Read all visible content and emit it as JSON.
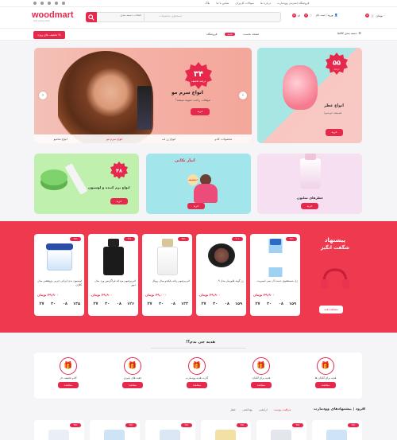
{
  "topbar": {
    "links": [
      "فروشگاه اینترنتی وودمارت",
      "درباره ما",
      "سوالات کاربران",
      "تماس با ما",
      "بلاگ"
    ],
    "social": [
      "instagram-icon",
      "telegram-icon",
      "twitter-icon",
      "aparat-icon",
      "whatsapp-icon"
    ]
  },
  "header": {
    "logo": "woodmart",
    "logo_sub": "Your online shop",
    "search_placeholder": "جستجوی محصولات",
    "category_select": "انتخاب دسته بندی",
    "login_label": "ورود / ثبت نام",
    "wishlist_count": "0",
    "compare_count": "0",
    "cart_label": "۰ تومان",
    "cart_count": "0"
  },
  "nav": {
    "categories_label": "دسته بندی کالاها",
    "items": [
      "صفحه نخست",
      "فروشگاه"
    ],
    "hot": "جدید",
    "cta": "% تخفیف های ویژه"
  },
  "hero": {
    "badge_value": "۳۴",
    "badge_unit": "درصد تخفیف",
    "title": "انواع سرم مو",
    "subtitle": "موهات راحت شونه میشه!",
    "button": "خرید",
    "tabs": [
      "محصولات کادو",
      "انواع رژ لب",
      "انواع سرم مو",
      "انواع شامپو"
    ]
  },
  "perfume_banner": {
    "badge_value": "۵۵",
    "badge_unit": "درصد",
    "title": "انواع عطر",
    "subtitle": "همیشه خوشبو!",
    "button": "خرید"
  },
  "small_banners": [
    {
      "badge": "۴۸",
      "title": "انواع نرم کننده و لوسیون",
      "button": "خرید"
    },
    {
      "badge": "",
      "title": "انبار تکانی",
      "tag": "٪تخفیف",
      "button": "خرید"
    },
    {
      "badge": "",
      "title": "عطرهای سلنون",
      "button": "خرید"
    }
  ],
  "amazing": {
    "line1": "پیشنهاد",
    "line2": "شگفت انگیز",
    "button": "مشاهده همه",
    "products": [
      {
        "name": "لوسیون بدن ایرانی چربی پژوهشی مدل کلاژن",
        "old": "",
        "price": "۳۹,۹۰۰ تومان",
        "disc": "۳۸٪",
        "timer": [
          "۱۳۵",
          "۰۸",
          "۳۰",
          "۲۷"
        ]
      },
      {
        "name": "ادو پرفیوم مردانه فراگرنس ورد مدل دیور",
        "old": "",
        "price": "۳۹,۹۰۰ تومان",
        "disc": "۲۹٪",
        "timer": [
          "۱۲۶",
          "۰۸",
          "۳۰",
          "۲۷"
        ]
      },
      {
        "name": "ادو پرفیوم زنانه بایلندو مدل رویال",
        "old": "",
        "price": "۴۹,۰۰۰ تومان",
        "disc": "۴۵٪",
        "timer": [
          "۱۳۳",
          "۰۸",
          "۳۰",
          "۲۷"
        ]
      },
      {
        "name": "رژ گونه فلورمار مدل ۰۹",
        "old": "",
        "price": "۳۹,۹۰۰ تومان",
        "disc": "۳۰٪",
        "timer": [
          "۱۵۹",
          "۰۸",
          "۳۰",
          "۲۷"
        ]
      },
      {
        "name": "ژل شستشوی دست آن سی اسپریت",
        "old": "",
        "price": "۳۹,۹۰۰ تومان",
        "disc": "۲۵٪",
        "timer": [
          "۱۵۹",
          "۰۸",
          "۳۰",
          "۲۷"
        ]
      }
    ]
  },
  "gift": {
    "title": "هدیه چی بدم؟!",
    "items": [
      {
        "label": "هدیه برای آقایان ها",
        "button": "مشاهده"
      },
      {
        "label": "هدیه برای آقایان",
        "button": "مشاهده"
      },
      {
        "label": "کارت هدیه وودمارت",
        "button": "مشاهده"
      },
      {
        "label": "جعبه های پاییزی",
        "button": "مشاهده"
      },
      {
        "label": "کادو تخفیف دار",
        "button": "مشاهده"
      }
    ]
  },
  "recommend": {
    "title": "آفرود | پیشنهادهای وودمارت",
    "tabs": [
      "مراقبت پوست",
      "آرایشی",
      "بهداشتی",
      "عطر"
    ],
    "discs": [
      "۲۵٪",
      "۲۵٪",
      "۲۵٪",
      "۲۵٪",
      "۲۵٪",
      "۲۵٪"
    ]
  },
  "colors": {
    "accent": "#e6284d",
    "amazing_bg": "#ef394e"
  }
}
